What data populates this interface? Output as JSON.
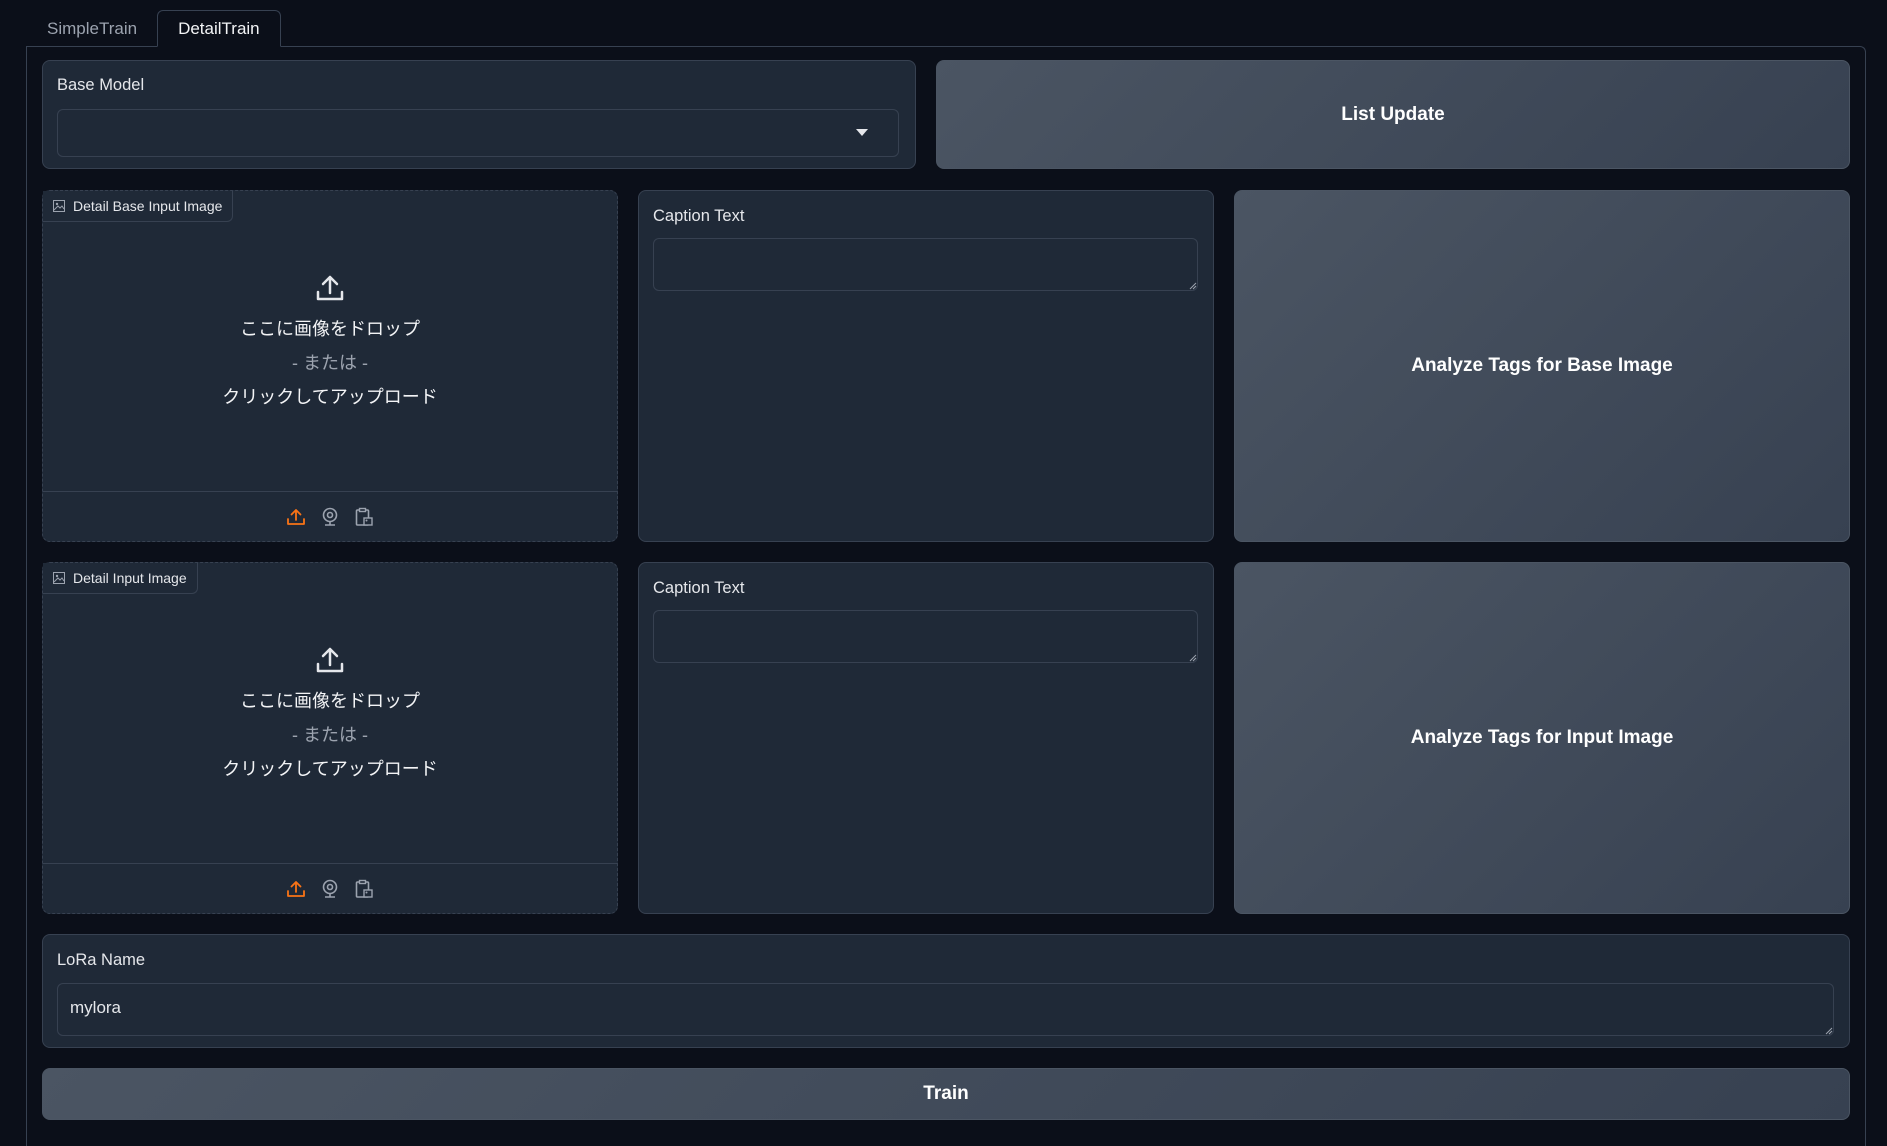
{
  "tabs": [
    {
      "label": "SimpleTrain",
      "active": false
    },
    {
      "label": "DetailTrain",
      "active": true
    }
  ],
  "base_model": {
    "label": "Base Model",
    "value": ""
  },
  "list_update_button": "List Update",
  "base_image": {
    "badge": "Detail Base Input Image",
    "drop_line1": "ここに画像をドロップ",
    "drop_line2": "- または -",
    "drop_line3": "クリックしてアップロード"
  },
  "base_caption": {
    "label": "Caption Text",
    "value": ""
  },
  "analyze_base_button": "Analyze Tags for Base Image",
  "input_image": {
    "badge": "Detail Input Image",
    "drop_line1": "ここに画像をドロップ",
    "drop_line2": "- または -",
    "drop_line3": "クリックしてアップロード"
  },
  "input_caption": {
    "label": "Caption Text",
    "value": ""
  },
  "analyze_input_button": "Analyze Tags for Input Image",
  "lora_name": {
    "label": "LoRa Name",
    "value": "mylora"
  },
  "train_button": "Train",
  "colors": {
    "background": "#0b0f19",
    "block": "#1f2937",
    "border": "#374151",
    "accent": "#f97316"
  },
  "icons": {
    "upload_large": "upload-icon",
    "footer": [
      "upload-icon",
      "webcam-icon",
      "clipboard-icon"
    ],
    "badge": "image-icon",
    "dropdown": "chevron-down-icon"
  }
}
